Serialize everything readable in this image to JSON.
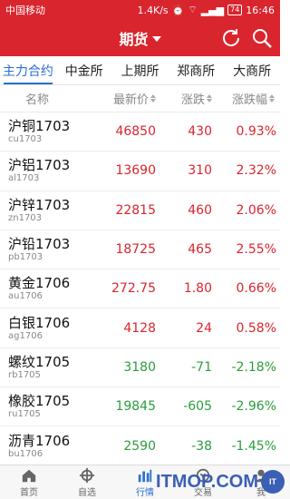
{
  "status": {
    "carrier": "中国移动",
    "speed": "1.4K/s",
    "battery": "74",
    "time": "16:46"
  },
  "header": {
    "title": "期货"
  },
  "tabs": [
    {
      "label": "主力合约",
      "active": true
    },
    {
      "label": "中金所",
      "active": false
    },
    {
      "label": "上期所",
      "active": false
    },
    {
      "label": "郑商所",
      "active": false
    },
    {
      "label": "大商所",
      "active": false
    }
  ],
  "columns": {
    "name": "名称",
    "price": "最新价",
    "change": "涨跌",
    "pct": "涨跌幅"
  },
  "rows": [
    {
      "name": "沪铜1703",
      "code": "cu1703",
      "price": "46850",
      "change": "430",
      "pct": "0.93%",
      "dir": "up"
    },
    {
      "name": "沪铝1703",
      "code": "al1703",
      "price": "13690",
      "change": "310",
      "pct": "2.32%",
      "dir": "up"
    },
    {
      "name": "沪锌1703",
      "code": "zn1703",
      "price": "22815",
      "change": "460",
      "pct": "2.06%",
      "dir": "up"
    },
    {
      "name": "沪铅1703",
      "code": "pb1703",
      "price": "18725",
      "change": "465",
      "pct": "2.55%",
      "dir": "up"
    },
    {
      "name": "黄金1706",
      "code": "au1706",
      "price": "272.75",
      "change": "1.80",
      "pct": "0.66%",
      "dir": "up"
    },
    {
      "name": "白银1706",
      "code": "ag1706",
      "price": "4128",
      "change": "24",
      "pct": "0.58%",
      "dir": "up"
    },
    {
      "name": "螺纹1705",
      "code": "rb1705",
      "price": "3180",
      "change": "-71",
      "pct": "-2.18%",
      "dir": "dn"
    },
    {
      "name": "橡胶1705",
      "code": "ru1705",
      "price": "19845",
      "change": "-605",
      "pct": "-2.96%",
      "dir": "dn"
    },
    {
      "name": "沥青1706",
      "code": "bu1706",
      "price": "2590",
      "change": "-38",
      "pct": "-1.45%",
      "dir": "dn"
    }
  ],
  "nav": [
    {
      "label": "首页",
      "icon": "home-icon"
    },
    {
      "label": "自选",
      "icon": "target-icon"
    },
    {
      "label": "行情",
      "icon": "chart-icon",
      "active": true
    },
    {
      "label": "交易",
      "icon": "trade-icon"
    },
    {
      "label": "我",
      "icon": "user-icon"
    }
  ],
  "watermark": {
    "text": "ITMOP.COM",
    "badge": "IT"
  },
  "colors": {
    "brand": "#d9252e",
    "accent": "#2b6fd0",
    "up": "#d9252e",
    "down": "#2a9d3c"
  }
}
